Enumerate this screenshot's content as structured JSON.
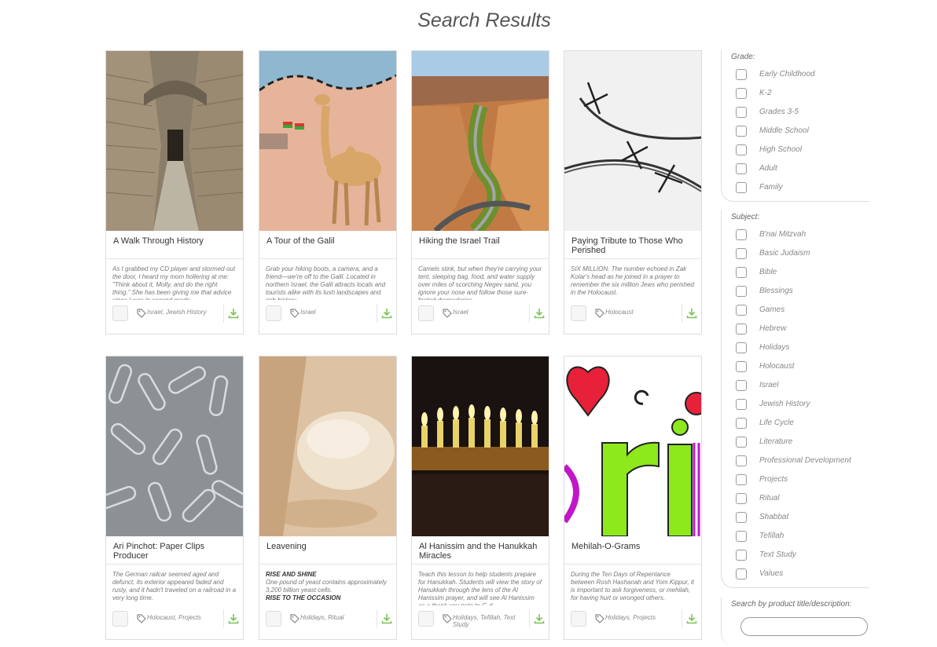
{
  "page": {
    "title": "Search Results"
  },
  "cards": [
    {
      "title": "A Walk Through History",
      "description": "As I grabbed my CD player and stormed out the door, I heard my mom hollering at me: \"Think about it, Molly, and do the right thing.\" She has been giving me that advice since I was in second grade.",
      "tags": "Israel, Jewish History",
      "image": "stone-alley-photo"
    },
    {
      "title": "A Tour of the Galil",
      "description": "Grab your hiking boots, a camera, and a friend—we're off to the Galil. Located in northern Israel, the Galil attracts locals and tourists alike with its lush landscapes and rich history.",
      "tags": "Israel",
      "image": "camel-map-illustration"
    },
    {
      "title": "Hiking the Israel Trail",
      "description": "Camels stink, but when they're carrying your tent, sleeping bag, food, and water supply over miles of scorching Negev sand, you ignore your nose and follow those sure-footed dromedaries.",
      "tags": "Israel",
      "image": "desert-canyon-photo"
    },
    {
      "title": "Paying Tribute to Those Who Perished",
      "description": "SIX MILLION. The number echoed in Zak Kolar's head as he joined in a prayer to remember the six million Jews who perished in the Holocaust.",
      "tags": "Holocaust",
      "image": "barbed-wire-photo"
    },
    {
      "title": "Ari Pinchot: Paper Clips Producer",
      "description": "The German railcar seemed aged and defunct, its exterior appeared faded and rusty, and it hadn't traveled on a railroad in a very long time.",
      "tags": "Holocaust, Projects",
      "image": "paper-clips-photo"
    },
    {
      "title": "Leavening",
      "desc_heading": "RISE AND SHINE",
      "description": "One pound of yeast contains approximately 3,200 billion yeast cells.",
      "desc_heading2": "RISE TO THE OCCASION",
      "tags": "Holidays, Ritual",
      "image": "bread-dough-photo"
    },
    {
      "title": "Al Hanissim and the Hanukkah Miracles",
      "description": "Teach this lesson to help students prepare for Hanukkah. Students will view the story of Hanukkah through the lens of the Al Hanissim prayer, and will see Al Hanissim as a thank you note to G-d.",
      "tags": "Holidays, Tefillah, Text Study",
      "image": "menorah-candles-photo"
    },
    {
      "title": "Mehilah-O-Grams",
      "description": "During the Ten Days of Repentance between Rosh Hashanah and Yom Kippur, it is important to ask forgiveness, or mehilah, for having hurt or wronged others.",
      "tags": "Holidays, Projects",
      "image": "colorful-letters-art"
    }
  ],
  "sidebar": {
    "grade_label": "Grade:",
    "grades": [
      "Early Childhood",
      "K-2",
      "Grades 3-5",
      "Middle School",
      "High School",
      "Adult",
      "Family"
    ],
    "subject_label": "Subject:",
    "subjects": [
      "B'nai Mitzvah",
      "Basic Judaism",
      "Bible",
      "Blessings",
      "Games",
      "Hebrew",
      "Holidays",
      "Holocaust",
      "Israel",
      "Jewish History",
      "Life Cycle",
      "Literature",
      "Professional Development",
      "Projects",
      "Ritual",
      "Shabbat",
      "Tefillah",
      "Text Study",
      "Values"
    ],
    "search_label": "Search by product title/description:",
    "search_value": ""
  },
  "colors": {
    "download": "#7cc35a",
    "border": "#dddddd",
    "text": "#444444"
  }
}
